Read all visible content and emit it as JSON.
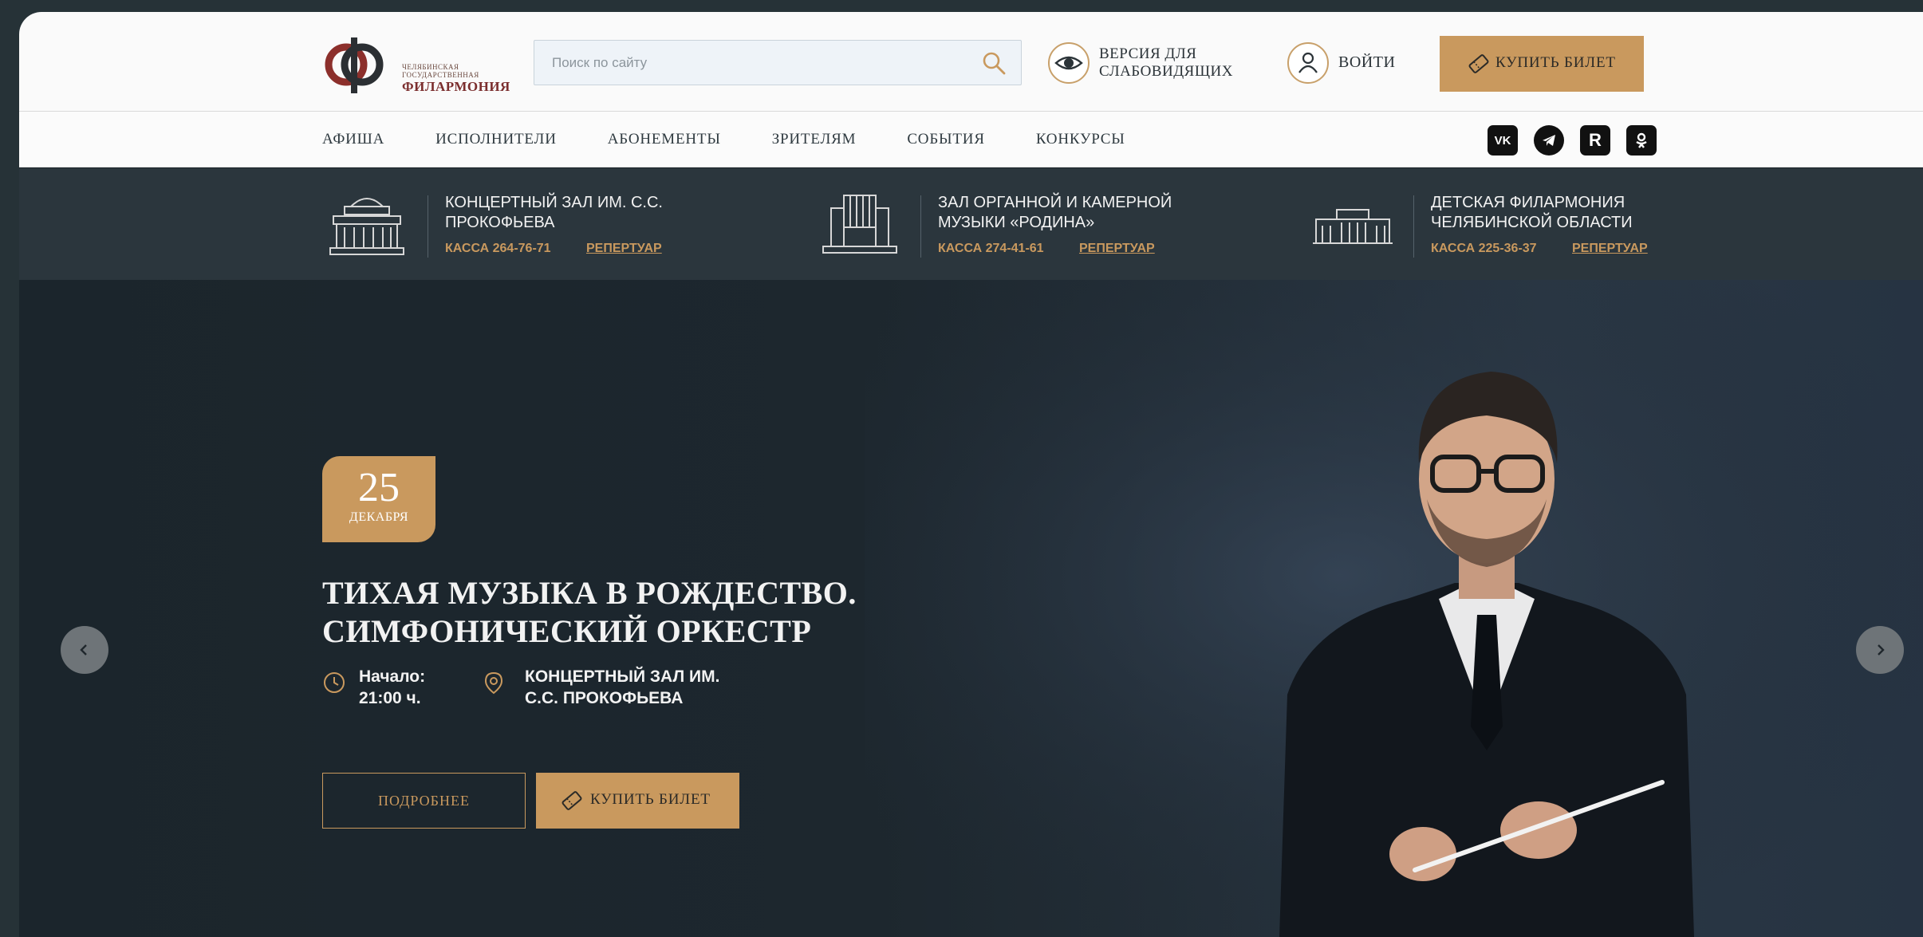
{
  "header": {
    "logo": {
      "line1": "ЧЕЛЯБИНСКАЯ",
      "line2": "ГОСУДАРСТВЕННАЯ",
      "line3": "ФИЛАРМОНИЯ",
      "icon": "philharmonic-logo-icon",
      "colors": {
        "dark": "#2b2f33",
        "accent": "#8c2f2b"
      }
    },
    "search": {
      "placeholder": "Поиск по сайту",
      "value": "",
      "icon": "search-icon"
    },
    "vision": {
      "label": "ВЕРСИЯ ДЛЯ СЛАБОВИДЯЩИХ",
      "icon": "eye-icon"
    },
    "login": {
      "label": "ВОЙТИ",
      "icon": "user-icon"
    },
    "buy": {
      "label": "КУПИТЬ БИЛЕТ",
      "icon": "ticket-icon"
    }
  },
  "nav": {
    "items": [
      "АФИША",
      "ИСПОЛНИТЕЛИ",
      "АБОНЕМЕНТЫ",
      "ЗРИТЕЛЯМ",
      "СОБЫТИЯ",
      "КОНКУРСЫ"
    ],
    "socials": [
      {
        "name": "vk-icon",
        "glyph": "VK"
      },
      {
        "name": "telegram-icon",
        "glyph": ""
      },
      {
        "name": "rutube-icon",
        "glyph": "R"
      },
      {
        "name": "odnoklassniki-icon",
        "glyph": ""
      }
    ]
  },
  "halls": [
    {
      "name": "КОНЦЕРТНЫЙ ЗАЛ ИМ. С.С. ПРОКОФЬЕВА",
      "phone": "КАССА 264-76-71",
      "repertoire": "РЕПЕРТУАР",
      "icon": "concert-hall-icon"
    },
    {
      "name": "ЗАЛ ОРГАННОЙ И КАМЕРНОЙ МУЗЫКИ «РОДИНА»",
      "phone": "КАССА 274-41-61",
      "repertoire": "РЕПЕРТУАР",
      "icon": "organ-hall-icon"
    },
    {
      "name": "ДЕТСКАЯ ФИЛАРМОНИЯ ЧЕЛЯБИНСКОЙ ОБЛАСТИ",
      "phone": "КАССА 225-36-37",
      "repertoire": "РЕПЕРТУАР",
      "icon": "children-hall-icon"
    }
  ],
  "hero": {
    "date_day": "25",
    "date_month": "ДЕКАБРЯ",
    "title_line1": "ТИХАЯ МУЗЫКА В РОЖДЕСТВО.",
    "title_line2": "СИМФОНИЧЕСКИЙ ОРКЕСТР",
    "start_label": "Начало:",
    "start_time": "21:00 ч.",
    "venue_line1": "КОНЦЕРТНЫЙ ЗАЛ ИМ.",
    "venue_line2": "С.С. ПРОКОФЬЕВА",
    "more_label": "ПОДРОБНЕЕ",
    "buy_label": "КУПИТЬ БИЛЕТ",
    "prev_icon": "chevron-left-icon",
    "next_icon": "chevron-right-icon"
  },
  "colors": {
    "accent": "#c9995e",
    "dark": "#1b252b",
    "strip": "#2b363d",
    "header_bg": "#fafafa"
  }
}
